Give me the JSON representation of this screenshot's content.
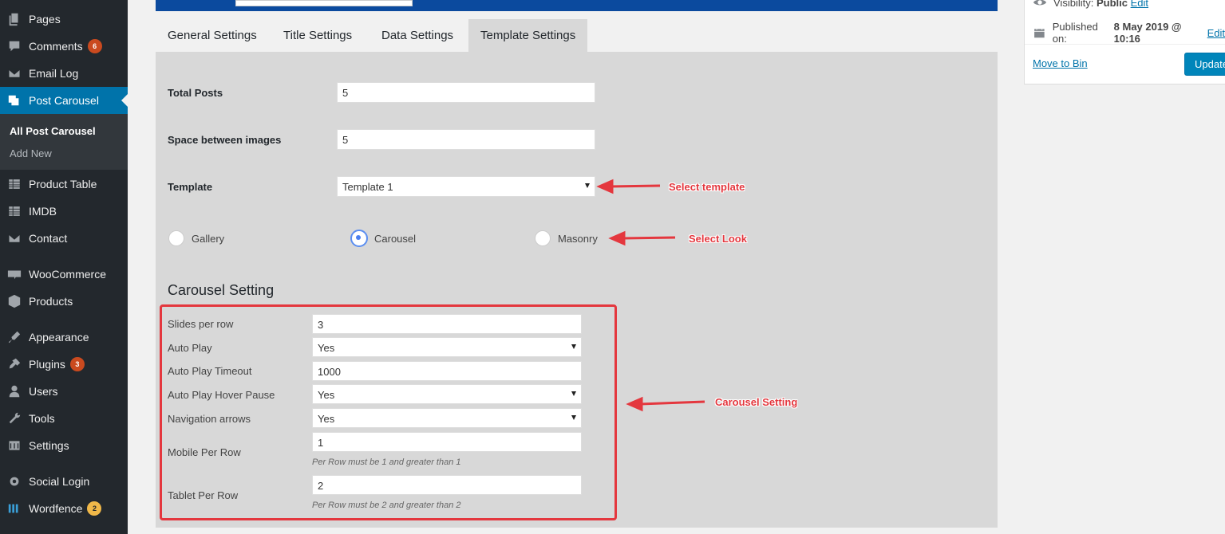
{
  "sidebar": {
    "items": [
      {
        "label": "Pages",
        "icon": "pages-icon"
      },
      {
        "label": "Comments",
        "icon": "comments-icon",
        "badge": "6"
      },
      {
        "label": "Email Log",
        "icon": "email-icon"
      },
      {
        "label": "Post Carousel",
        "icon": "post-carousel-icon",
        "active": true
      },
      {
        "label": "Product Table",
        "icon": "table-icon"
      },
      {
        "label": "IMDB",
        "icon": "table-icon"
      },
      {
        "label": "Contact",
        "icon": "email-icon"
      },
      {
        "label": "WooCommerce",
        "icon": "woocommerce-icon"
      },
      {
        "label": "Products",
        "icon": "products-icon"
      },
      {
        "label": "Appearance",
        "icon": "appearance-icon"
      },
      {
        "label": "Plugins",
        "icon": "plugins-icon",
        "badge": "3"
      },
      {
        "label": "Users",
        "icon": "users-icon"
      },
      {
        "label": "Tools",
        "icon": "tools-icon"
      },
      {
        "label": "Settings",
        "icon": "settings-icon"
      },
      {
        "label": "Social Login",
        "icon": "gear-icon"
      },
      {
        "label": "Wordfence",
        "icon": "wordfence-icon",
        "badge": "2"
      }
    ],
    "submenu": {
      "current": "All Post Carousel",
      "add_new": "Add New"
    }
  },
  "tabs": [
    "General Settings",
    "Title Settings",
    "Data Settings",
    "Template Settings"
  ],
  "template_settings": {
    "total_posts_label": "Total Posts",
    "total_posts_value": "5",
    "space_label": "Space between images",
    "space_value": "5",
    "template_label": "Template",
    "template_value": "Template 1",
    "looks": [
      {
        "label": "Gallery",
        "checked": false
      },
      {
        "label": "Carousel",
        "checked": true
      },
      {
        "label": "Masonry",
        "checked": false
      }
    ]
  },
  "carousel": {
    "title": "Carousel Setting",
    "slides_label": "Slides per row",
    "slides_value": "3",
    "autoplay_label": "Auto Play",
    "autoplay_value": "Yes",
    "timeout_label": "Auto Play Timeout",
    "timeout_value": "1000",
    "hover_label": "Auto Play Hover Pause",
    "hover_value": "Yes",
    "arrows_label": "Navigation arrows",
    "arrows_value": "Yes",
    "mobile_label": "Mobile Per Row",
    "mobile_value": "1",
    "mobile_hint": "Per Row must be 1 and greater than 1",
    "tablet_label": "Tablet Per Row",
    "tablet_value": "2",
    "tablet_hint": "Per Row must be 2 and greater than 2"
  },
  "annotations": {
    "select_template": "Select template",
    "select_look": "Select Look",
    "carousel_setting": "Carousel Setting"
  },
  "publish": {
    "visibility": "Visibility:",
    "visibility_value": "Public",
    "visibility_edit": "Edit",
    "published_on": "Published on:",
    "published_value": "8 May 2019 @ 10:16",
    "published_edit": "Edit",
    "move_to_bin": "Move to Bin",
    "update": "Update"
  },
  "colors": {
    "accent": "#0073aa",
    "annotation": "#e4373e",
    "sidebar": "#23282d",
    "panel": "#d8d8d8"
  }
}
